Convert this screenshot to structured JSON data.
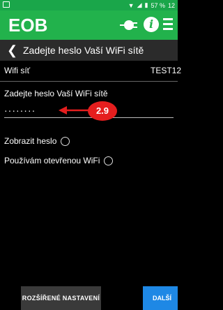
{
  "status": {
    "battery": "57 %",
    "time": "12"
  },
  "header": {
    "brand": "EOB"
  },
  "titlebar": {
    "title": "Zadejte heslo Vaší WiFi sítě"
  },
  "wifi": {
    "label": "Wifi síť",
    "value": "TEST12"
  },
  "password": {
    "label": "Zadejte heslo Vaší WiFi sítě",
    "masked_value": "········"
  },
  "annotation": {
    "label": "2.9",
    "color": "#e51e1e"
  },
  "options": {
    "show_password": "Zobrazit heslo",
    "open_wifi": "Používám otevřenou WiFi"
  },
  "buttons": {
    "advanced": "ROZŠÍŘENÉ NASTAVENÍ",
    "next": "DALŠÍ"
  },
  "colors": {
    "statusbar": "#1aa64a",
    "appbar": "#22b24c",
    "titlebar": "#2b2b2b",
    "next_button": "#1e88e5"
  }
}
